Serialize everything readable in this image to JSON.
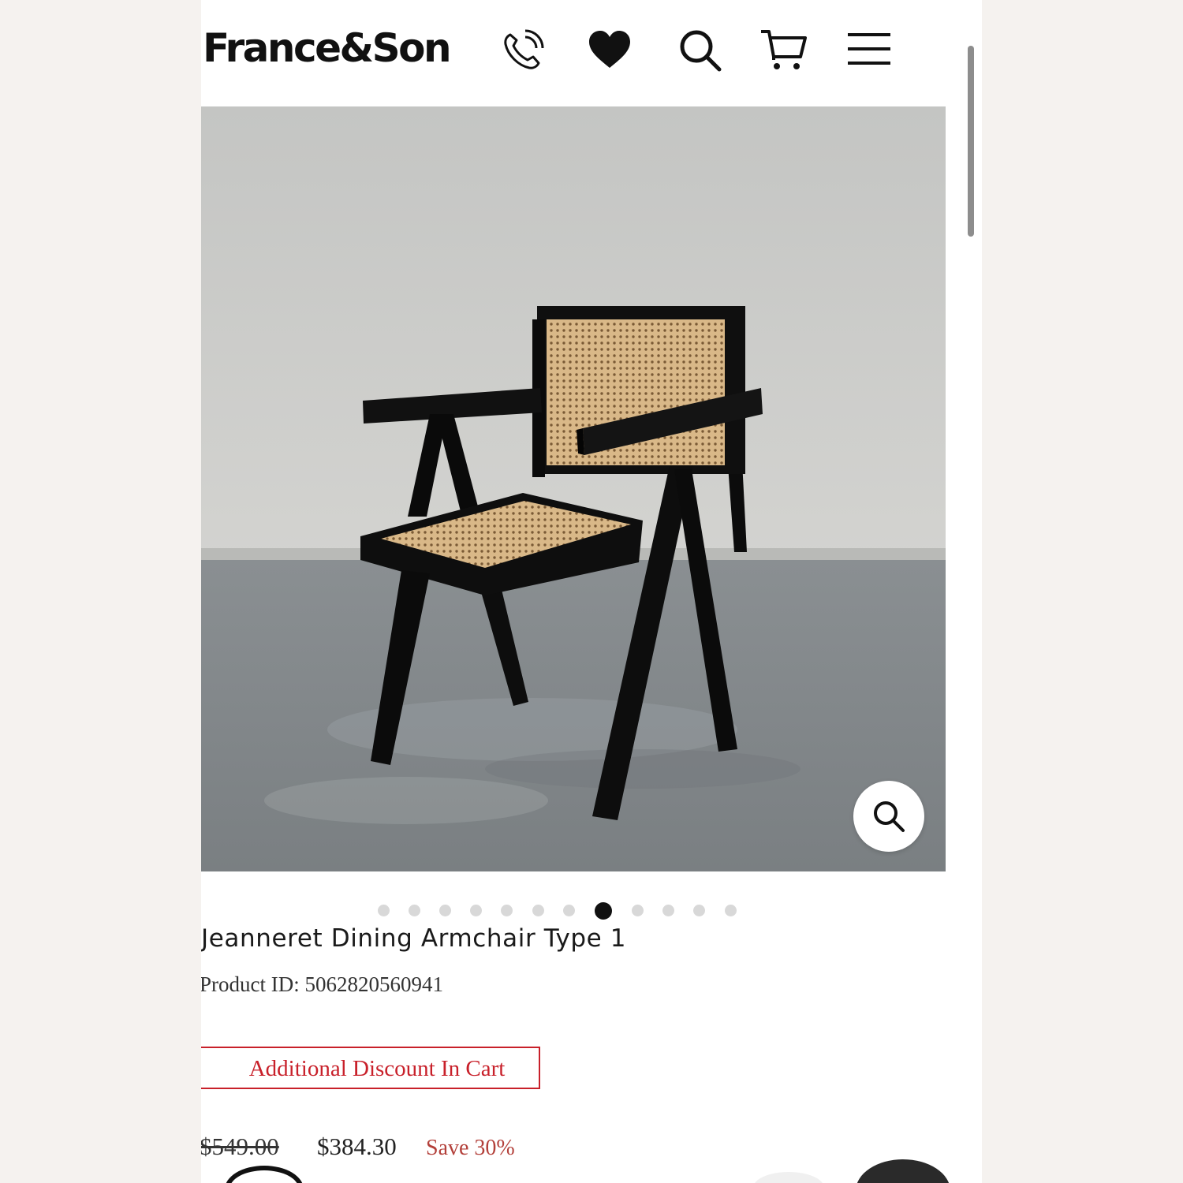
{
  "header": {
    "logo": "France&Son",
    "icons": [
      "phone-icon",
      "heart-icon",
      "search-icon",
      "cart-icon",
      "menu-icon"
    ]
  },
  "gallery": {
    "image_alt": "Black wooden armchair with natural cane seat and back",
    "total_images": 12,
    "active_index": 7
  },
  "product": {
    "title": "Jeanneret Dining Armchair Type 1",
    "product_id": "Product ID: 5062820560941",
    "discount_badge": "Additional Discount In Cart",
    "original_price": "$549.00",
    "sale_price": "$384.30",
    "savings": "Save 30%"
  },
  "colors": {
    "accent_red": "#c8202a",
    "save_text": "#b3403a"
  }
}
